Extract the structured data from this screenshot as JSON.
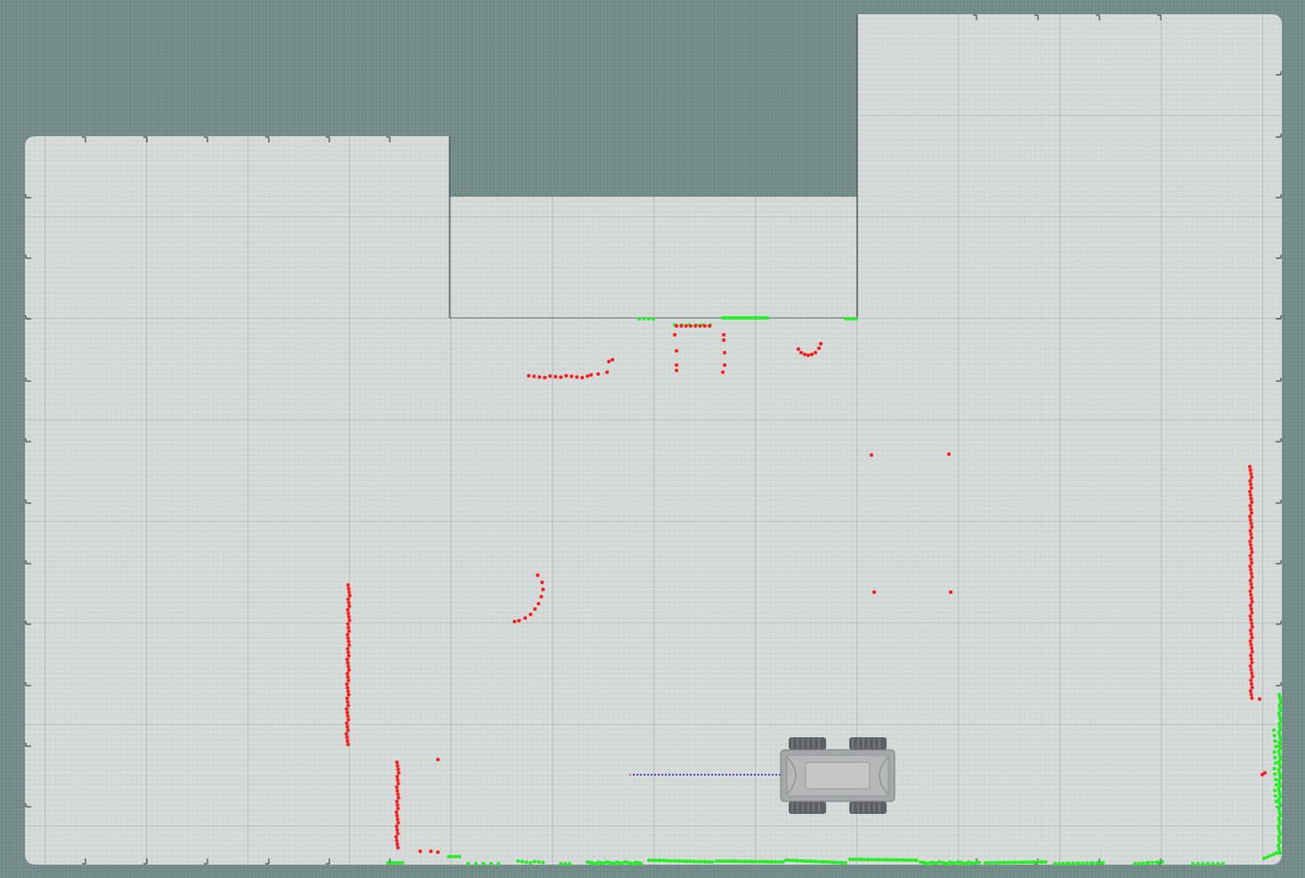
{
  "scene": {
    "background_color": "#6f8886",
    "floor_color": "#d7dcdb",
    "grid_minor_color": "#b9c4c3",
    "grid_major_color": "#8e9c9b",
    "wall_color": "#3d4847",
    "obstacle_points_color": "#ff1a1a",
    "floor_points_color": "#22ee22",
    "robot_body_color": "#9a9d9f",
    "robot_wheel_color": "#5c6064",
    "path_colors": [
      "#ff2a2a",
      "#2a2aff"
    ]
  },
  "robot": {
    "icon": "four-wheel-rover-icon",
    "heading": "left"
  },
  "laser_scan": {
    "obstacle_layer": "red-points",
    "floor_layer": "green-points"
  }
}
